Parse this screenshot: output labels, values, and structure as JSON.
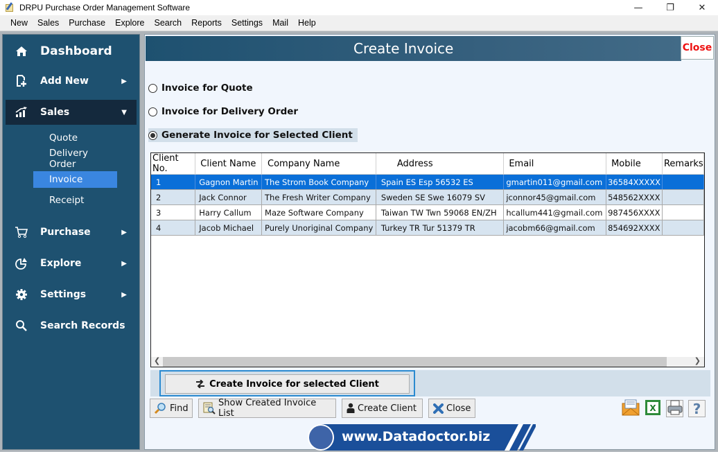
{
  "window": {
    "title": "DRPU Purchase Order Management Software",
    "controls": [
      "minimize",
      "maximize",
      "close"
    ]
  },
  "menu": [
    "New",
    "Sales",
    "Purchase",
    "Explore",
    "Search",
    "Reports",
    "Settings",
    "Mail",
    "Help"
  ],
  "sidebar": {
    "dashboard": "Dashboard",
    "add_new": "Add New",
    "sales": "Sales",
    "sales_sub": [
      "Quote",
      "Delivery Order",
      "Invoice",
      "Receipt"
    ],
    "active_sub": "Invoice",
    "purchase": "Purchase",
    "explore": "Explore",
    "settings": "Settings",
    "search_records": "Search Records"
  },
  "header": {
    "title": "Create Invoice",
    "close_label": "Close"
  },
  "options": {
    "items": [
      "Invoice for Quote",
      "Invoice for Delivery Order",
      "Generate Invoice for Selected Client"
    ],
    "selected": "Generate Invoice for Selected Client"
  },
  "table": {
    "columns": [
      "Client No.",
      "Client Name",
      "Company Name",
      "Address",
      "Email",
      "Mobile",
      "Remarks"
    ],
    "rows": [
      [
        "1",
        "Gagnon Martin",
        "The Strom Book Company",
        "Spain ES Esp 56532 ES",
        "gmartin011@gmail.com",
        "36584XXXXX",
        ""
      ],
      [
        "2",
        "Jack Connor",
        "The Fresh Writer Company",
        "Sweden SE Swe 16079 SV",
        "jconnor45@gmail.com",
        "548562XXXX",
        ""
      ],
      [
        "3",
        "Harry Callum",
        "Maze Software Company",
        "Taiwan TW Twn 59068 EN/ZH",
        "hcallum441@gmail.com",
        "987456XXXX",
        ""
      ],
      [
        "4",
        "Jacob Michael",
        "Purely Unoriginal Company",
        "Turkey TR Tur 51379 TR",
        "jacobm66@gmail.com",
        "854692XXXX",
        ""
      ]
    ],
    "selected_row": 0
  },
  "actions": {
    "create_invoice": "Create Invoice for selected Client",
    "find": "Find",
    "show_list": "Show Created Invoice List",
    "create_client": "Create Client",
    "close": "Close"
  },
  "banner": {
    "text": "www.Datadoctor.biz"
  }
}
